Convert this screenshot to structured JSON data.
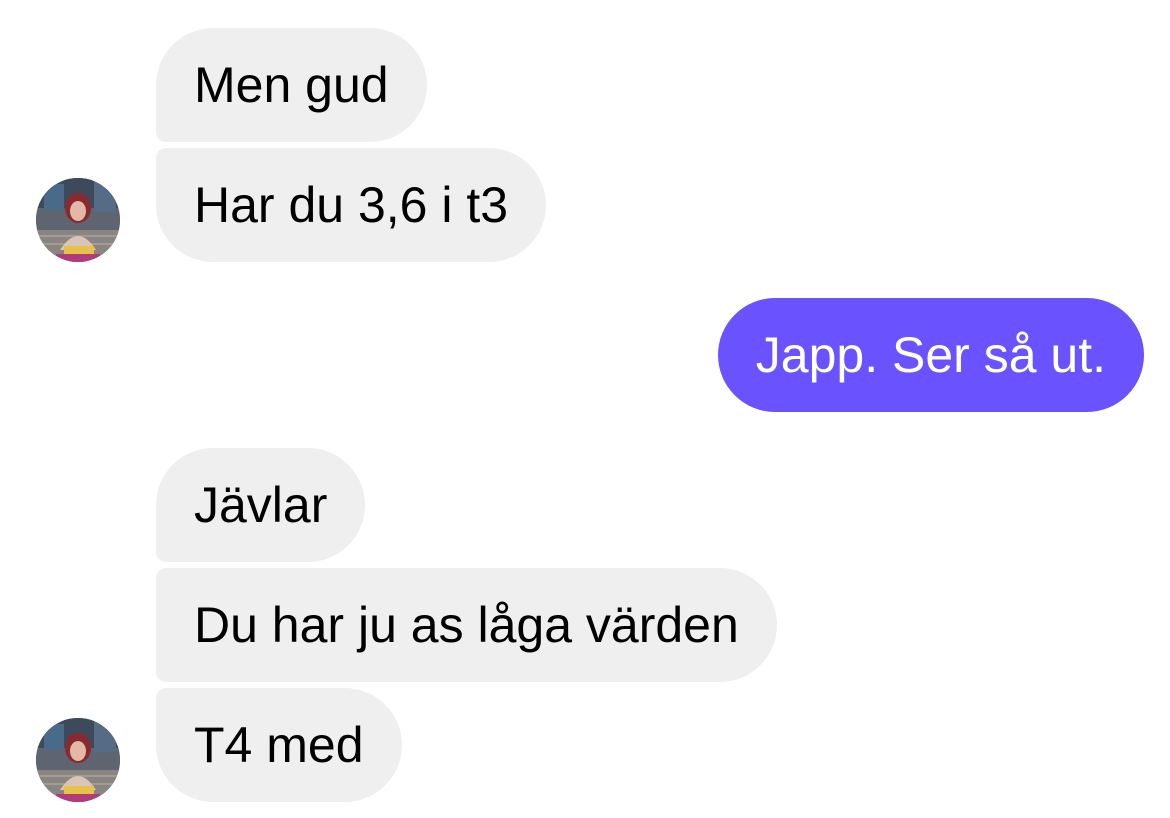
{
  "conversation": {
    "contact_avatar_icon": "avatar-photo",
    "messages": [
      {
        "sender": "contact",
        "text": "Men gud"
      },
      {
        "sender": "contact",
        "text": "Har du 3,6 i t3"
      },
      {
        "sender": "me",
        "text": "Japp. Ser så ut."
      },
      {
        "sender": "contact",
        "text": "Jävlar"
      },
      {
        "sender": "contact",
        "text": "Du har ju as låga värden"
      },
      {
        "sender": "contact",
        "text": "T4 med"
      }
    ]
  },
  "colors": {
    "incoming_bubble": "#efefef",
    "outgoing_bubble": "#6a52ff",
    "incoming_text": "#000000",
    "outgoing_text": "#ffffff"
  }
}
